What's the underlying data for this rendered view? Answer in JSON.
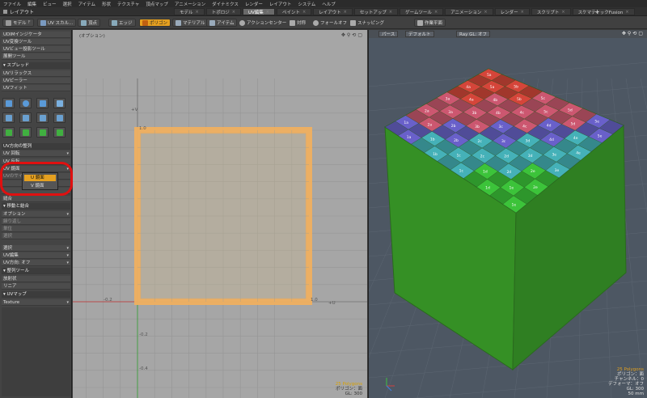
{
  "menu": [
    "ファイル",
    "編集",
    "ビュー",
    "選択",
    "アイテム",
    "形状",
    "テクスチャ",
    "頂点マップ",
    "アニメーション",
    "ダイナミクス",
    "レンダー",
    "レイアウト",
    "システム",
    "ヘルプ"
  ],
  "layout_name": "レイアウト",
  "tabs": [
    {
      "label": "モデル",
      "active": false
    },
    {
      "label": "トポロジ",
      "active": false
    },
    {
      "label": "UV編集",
      "active": true
    },
    {
      "label": "ペイント",
      "active": false
    },
    {
      "label": "レイアウト",
      "active": false
    },
    {
      "label": "セットアップ",
      "active": false
    },
    {
      "label": "ゲームツール",
      "active": false
    },
    {
      "label": "アニメーション",
      "active": false
    },
    {
      "label": "レンダー",
      "active": false
    },
    {
      "label": "スクリプト",
      "active": false
    },
    {
      "label": "スケマティックFusion",
      "active": false
    }
  ],
  "tab_add": "+",
  "toolbar": {
    "model": "モデル",
    "model_key": "F",
    "uv_scale": "UV スカル...",
    "vertex": "頂点",
    "edge": "エッジ",
    "polygon": "ポリゴン",
    "material": "マテリアル",
    "item": "アイテム",
    "action_center": "アクションセンター",
    "symmetry": "対称",
    "falloff": "フォールオフ",
    "snapping": "スナッピング",
    "workplane": "作業平面"
  },
  "left_panel": {
    "rows_top": [
      "UDIMインジケータ",
      "UV変換ツール",
      "UVビュー投影ツール",
      "展開ツール"
    ],
    "relax_header": "スプレッド",
    "rows_mid": [
      "UVリラックス",
      "UVピーラー",
      "UVフィット"
    ],
    "align_header": "UV方向の整列",
    "uv_rotate": "UV 回転",
    "uv_flip": "UV 反転",
    "flip_select": "UV 鏡面",
    "dim_rows": [
      "UVのサイズ",
      "",
      ""
    ],
    "stitch": "縫合",
    "move_merge": "移動と結合",
    "options": "オプション",
    "dim_rows2": [
      "繰り返し",
      "単位",
      "選択"
    ],
    "select": "選択",
    "uv_edit": "UV編集",
    "uv_align_off": "UV方向: オフ",
    "align_tools": "整列ツール",
    "radial": "放射状",
    "linear": "リニア",
    "uvmap_header": "UVマップ",
    "texture": "Texture"
  },
  "popup": {
    "option_u": "U 鏡面",
    "option_v": "V 鏡面"
  },
  "uv_view": {
    "label": "(オプション)",
    "tick_labels": {
      "y1": "1.0",
      "x1": "1.0",
      "xm": "-0.2",
      "ym2": "-0.2",
      "ym4": "-0.4",
      "yv": "+V",
      "xu": "+U"
    },
    "info_polygons": "25 Polygons",
    "info_line2": "ポリゴン：面",
    "info_line3": "GL: 300",
    "quad_color": "#f0b060"
  },
  "view3d": {
    "perspective": "パース",
    "default": "デフォルト",
    "raygl": "Ray GL: オフ",
    "info_polygons": "25 Polygons",
    "info_lines": [
      "ポリゴン：面",
      "チャンネル：0",
      "デフォーマ：オフ",
      "GL: 300",
      "50 mm"
    ],
    "cube_color": "#3c9a2a",
    "checker_labels": [
      "1a",
      "1b",
      "1c",
      "1d",
      "1e",
      "2a",
      "2b",
      "2c",
      "2d",
      "2e",
      "3a",
      "3b",
      "3c",
      "3d",
      "3e",
      "4a",
      "4b",
      "4c",
      "4d",
      "4e",
      "5a",
      "5b",
      "5c",
      "5d",
      "5e"
    ]
  }
}
